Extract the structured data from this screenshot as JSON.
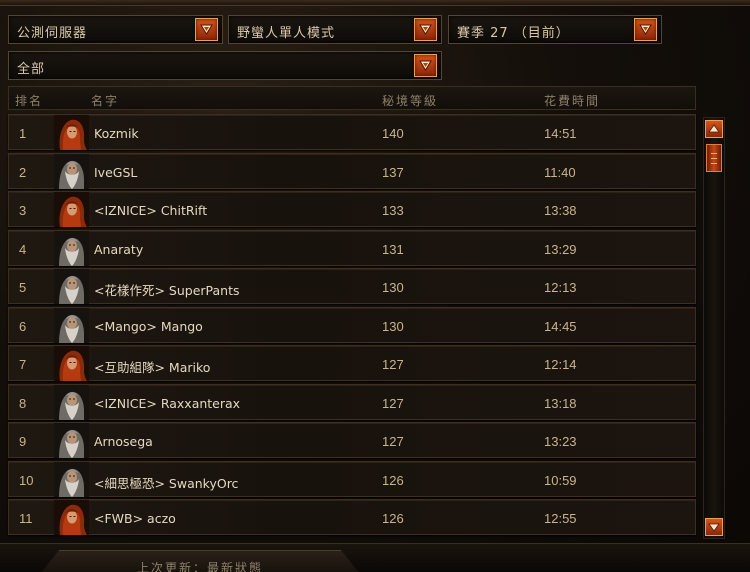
{
  "filters": {
    "region": "公測伺服器",
    "mode": "野蠻人單人模式",
    "season": "賽季 27 （目前）",
    "class_filter": "全部"
  },
  "columns": {
    "rank": "排名",
    "name": "名字",
    "rift_level": "秘境等級",
    "time_spent": "花費時間"
  },
  "rows": [
    {
      "rank": "1",
      "name": "Kozmik",
      "level": "140",
      "time": "14:51",
      "portrait": "female-barbarian-icon"
    },
    {
      "rank": "2",
      "name": "IveGSL",
      "level": "137",
      "time": "11:40",
      "portrait": "male-barbarian-icon"
    },
    {
      "rank": "3",
      "name": "<IZNICE> ChitRift",
      "level": "133",
      "time": "13:38",
      "portrait": "female-barbarian-icon"
    },
    {
      "rank": "4",
      "name": "Anaraty",
      "level": "131",
      "time": "13:29",
      "portrait": "male-barbarian-icon"
    },
    {
      "rank": "5",
      "name": "<花樣作死> SuperPants",
      "level": "130",
      "time": "12:13",
      "portrait": "male-barbarian-icon"
    },
    {
      "rank": "6",
      "name": "<Mango> Mango",
      "level": "130",
      "time": "14:45",
      "portrait": "male-barbarian-icon"
    },
    {
      "rank": "7",
      "name": "<互助組隊> Mariko",
      "level": "127",
      "time": "12:14",
      "portrait": "female-barbarian-icon"
    },
    {
      "rank": "8",
      "name": "<IZNICE> Raxxanterax",
      "level": "127",
      "time": "13:18",
      "portrait": "male-barbarian-icon"
    },
    {
      "rank": "9",
      "name": "Arnosega",
      "level": "127",
      "time": "13:23",
      "portrait": "male-barbarian-icon"
    },
    {
      "rank": "10",
      "name": "<細思極恐> SwankyOrc",
      "level": "126",
      "time": "10:59",
      "portrait": "male-barbarian-icon"
    },
    {
      "rank": "11",
      "name": "<FWB> aczo",
      "level": "126",
      "time": "12:55",
      "portrait": "female-barbarian-icon"
    }
  ],
  "footer": {
    "last_updated": "上次更新：最新狀態"
  },
  "colors": {
    "accent_orange": "#c24a16",
    "text_gold": "#c8b48e",
    "panel_border": "#3c2f21"
  }
}
